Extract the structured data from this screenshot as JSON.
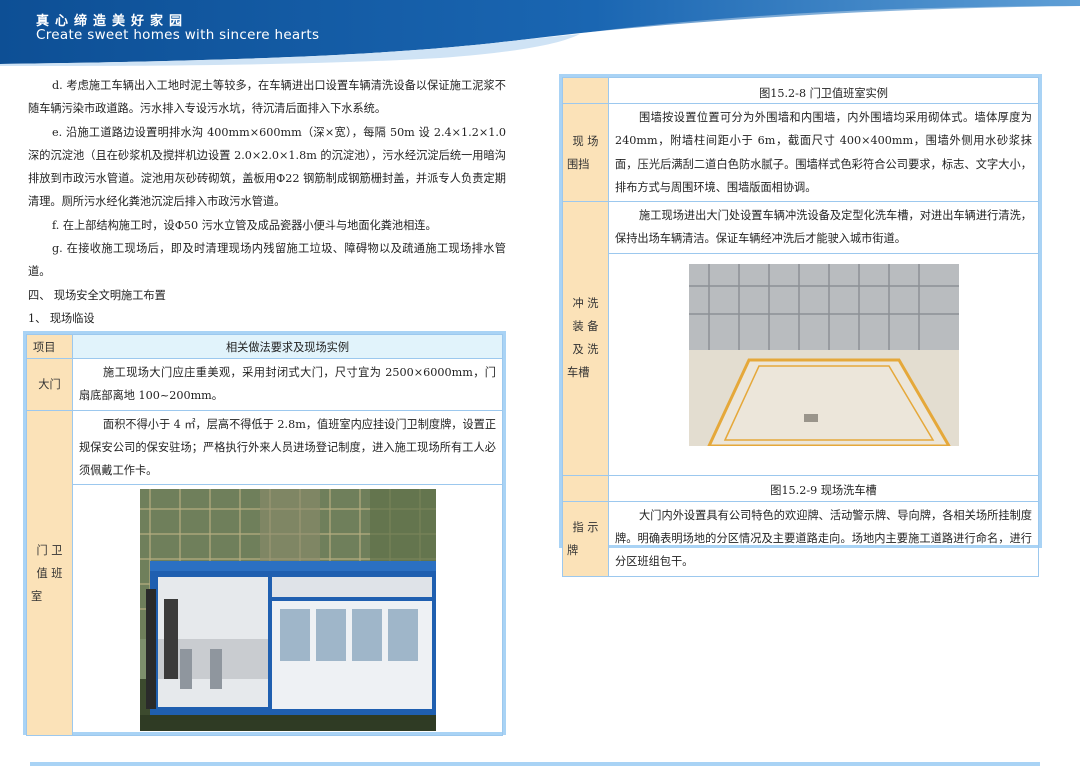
{
  "header": {
    "slogan_cn": "真心缔造美好家园",
    "slogan_en": "Create sweet homes with sincere hearts"
  },
  "left_text": {
    "p_d": "d. 考虑施工车辆出入工地时泥土等较多，在车辆进出口设置车辆清洗设备以保证施工泥浆不随车辆污染市政道路。污水排入专设污水坑，待沉清后面排入下水系统。",
    "p_e": "e. 沿施工道路边设置明排水沟 400mm×600mm（深×宽），每隔 50m 设 2.4×1.2×1.0 深的沉淀池（且在砂浆机及搅拌机边设置 2.0×2.0×1.8m 的沉淀池），污水经沉淀后统一用暗沟排放到市政污水管道。淀池用灰砂砖砌筑，盖板用Φ22 钢筋制成钢筋栅封盖，并派专人负责定期清理。厕所污水经化粪池沉淀后排入市政污水管道。",
    "p_f": "f. 在上部结构施工时，设Φ50 污水立管及成品瓷器小便斗与地面化粪池相连。",
    "p_g": "g. 在接收施工现场后，即及时清理现场内残留施工垃圾、障碍物以及疏通施工现场排水管道。",
    "heading_4": "四、  现场安全文明施工布置",
    "heading_1": "1、  现场临设"
  },
  "left_table": {
    "col1": "项目",
    "col2": "相关做法要求及现场实例",
    "gate_label": "大门",
    "gate_text": "施工现场大门应庄重美观，采用封闭式大门，尺寸宜为 2500×6000mm，门扇底部离地 100~200mm。",
    "guard_label_1": "门  卫",
    "guard_label_2": "值  班",
    "guard_label_3": "室",
    "guard_text": "面积不得小于 4 ㎡，层高不得低于 2.8m，值班室内应挂设门卫制度牌，设置正规保安公司的保安驻场；严格执行外来人员进场登记制度，进入施工现场所有工人必须佩戴工作卡。"
  },
  "right_table": {
    "caption_top": "图15.2-8  门卫值班室实例",
    "fence_label_1": "现  场",
    "fence_label_2": "围挡",
    "fence_text": "围墙按设置位置可分为外围墙和内围墙，内外围墙均采用砌体式。墙体厚度为 240mm，附墙柱间距小于 6m，截面尺寸 400×400mm，围墙外侧用水砂浆抹面，压光后满刮二道白色防水腻子。围墙样式色彩符合公司要求，标志、文字大小，排布方式与周围环境、围墙版面相协调。",
    "wash_label_1": "冲  洗",
    "wash_label_2": "装  备",
    "wash_label_3": "及  洗",
    "wash_label_4": "车槽",
    "wash_text": "施工现场进出大门处设置车辆冲洗设备及定型化洗车槽，对进出车辆进行清洗，保持出场车辆清洁。保证车辆经冲洗后才能驶入城市街道。",
    "caption_wash": "图15.2-9  现场洗车槽",
    "sign_label_1": "指  示",
    "sign_label_2": "牌",
    "sign_text": "大门内外设置具有公司特色的欢迎牌、活动警示牌、导向牌，各相关场所挂制度牌。明确表明场地的分区情况及主要道路走向。场地内主要施工道路进行命名，进行分区班组包干。"
  },
  "colors": {
    "header_blue": "#1560a8",
    "table_border": "#a9d3f5",
    "label_bg": "#fbe2b8",
    "header_bg": "#e1f3fb"
  }
}
